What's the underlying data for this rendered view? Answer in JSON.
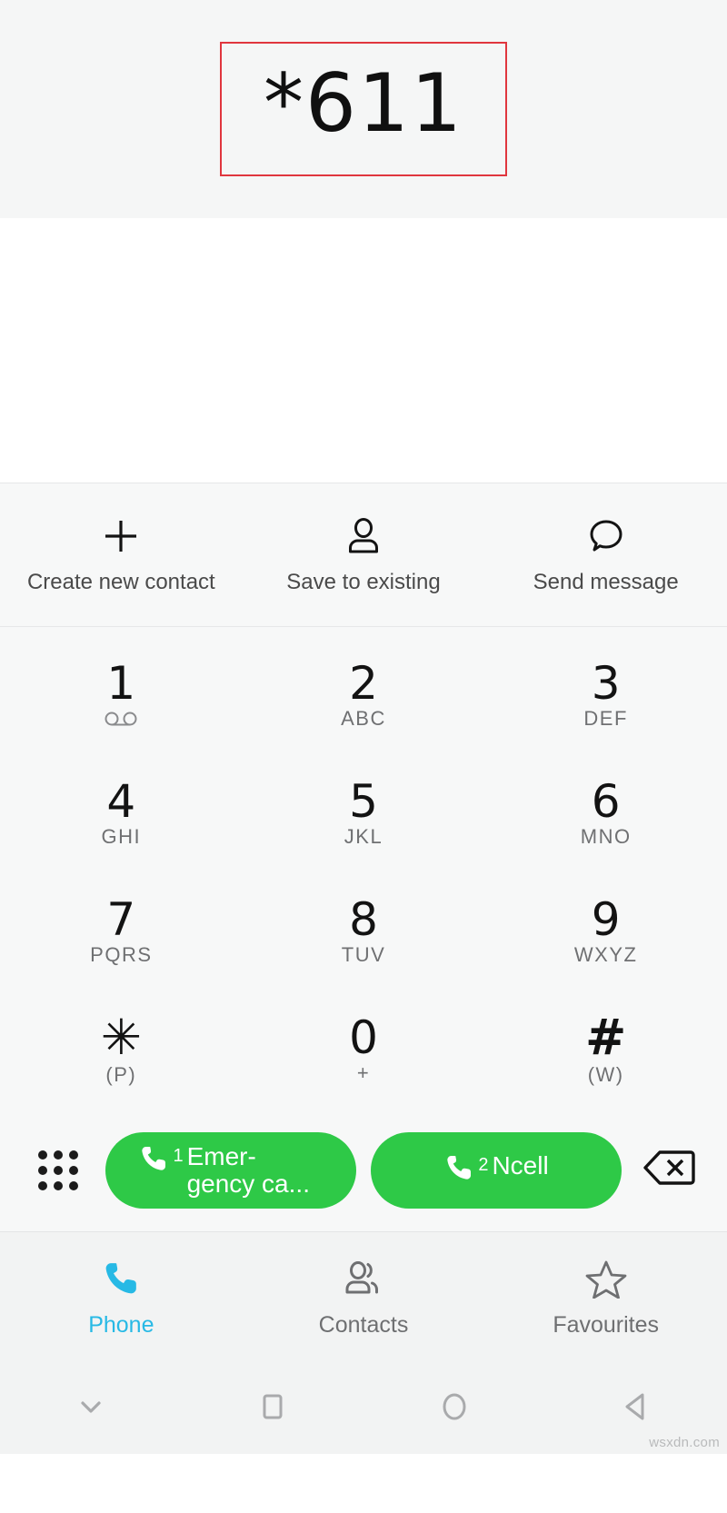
{
  "dialer": {
    "entered_number": "*611",
    "highlight_color": "#e0363e"
  },
  "quick_actions": [
    {
      "label": "Create new contact",
      "icon": "plus-icon"
    },
    {
      "label": "Save to existing",
      "icon": "person-icon"
    },
    {
      "label": "Send message",
      "icon": "message-bubble-icon"
    }
  ],
  "keypad": {
    "keys": [
      {
        "digit": "1",
        "sub": "",
        "icon": "voicemail-icon"
      },
      {
        "digit": "2",
        "sub": "ABC",
        "icon": ""
      },
      {
        "digit": "3",
        "sub": "DEF",
        "icon": ""
      },
      {
        "digit": "4",
        "sub": "GHI",
        "icon": ""
      },
      {
        "digit": "5",
        "sub": "JKL",
        "icon": ""
      },
      {
        "digit": "6",
        "sub": "MNO",
        "icon": ""
      },
      {
        "digit": "7",
        "sub": "PQRS",
        "icon": ""
      },
      {
        "digit": "8",
        "sub": "TUV",
        "icon": ""
      },
      {
        "digit": "9",
        "sub": "WXYZ",
        "icon": ""
      },
      {
        "digit": "✳",
        "sub": "(P)",
        "icon": ""
      },
      {
        "digit": "0",
        "sub": "+",
        "icon": ""
      },
      {
        "digit": "#",
        "sub": "(W)",
        "icon": ""
      }
    ]
  },
  "call_bar": {
    "dialpad_toggle_icon": "dialpad-dots-icon",
    "backspace_icon": "backspace-icon",
    "buttons": [
      {
        "sim": "1",
        "label": "Emer-gency ca...",
        "color": "#2ec947",
        "icon": "phone-handset-icon"
      },
      {
        "sim": "2",
        "label": "Ncell",
        "color": "#2ec947",
        "icon": "phone-handset-icon"
      }
    ]
  },
  "tabs": [
    {
      "label": "Phone",
      "icon": "phone-handset-icon",
      "active": true,
      "color": "#27b9e5"
    },
    {
      "label": "Contacts",
      "icon": "people-icon",
      "active": false,
      "color": "#6e6f71"
    },
    {
      "label": "Favourites",
      "icon": "star-icon",
      "active": false,
      "color": "#6e6f71"
    }
  ],
  "nav_bar": {
    "buttons": [
      {
        "icon": "chevron-down-icon"
      },
      {
        "icon": "square-recents-icon"
      },
      {
        "icon": "circle-home-icon"
      },
      {
        "icon": "triangle-back-icon"
      }
    ],
    "watermark": "wsxdn.com"
  }
}
